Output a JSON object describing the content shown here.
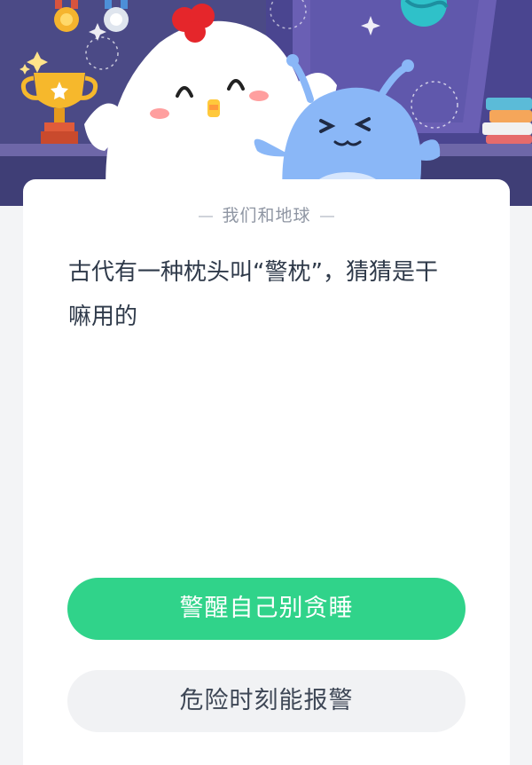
{
  "quiz": {
    "category": "我们和地球",
    "question": "古代有一种枕头叫“警枕”，猜猜是干嘛用的",
    "options": [
      {
        "label": "警醒自己别贪睡",
        "selected": true
      },
      {
        "label": "危险时刻能报警",
        "selected": false
      }
    ]
  },
  "colors": {
    "header_bg": "#4b4a86",
    "selected_option_bg": "#30d38a",
    "unselected_option_bg": "#f1f2f4",
    "question_text": "#2f3a4a",
    "category_text": "#8f96a3"
  },
  "icons": [
    "trophy-icon",
    "medal-icon",
    "sparkle-icon",
    "chicken-mascot",
    "alien-mascot",
    "books-icon"
  ]
}
